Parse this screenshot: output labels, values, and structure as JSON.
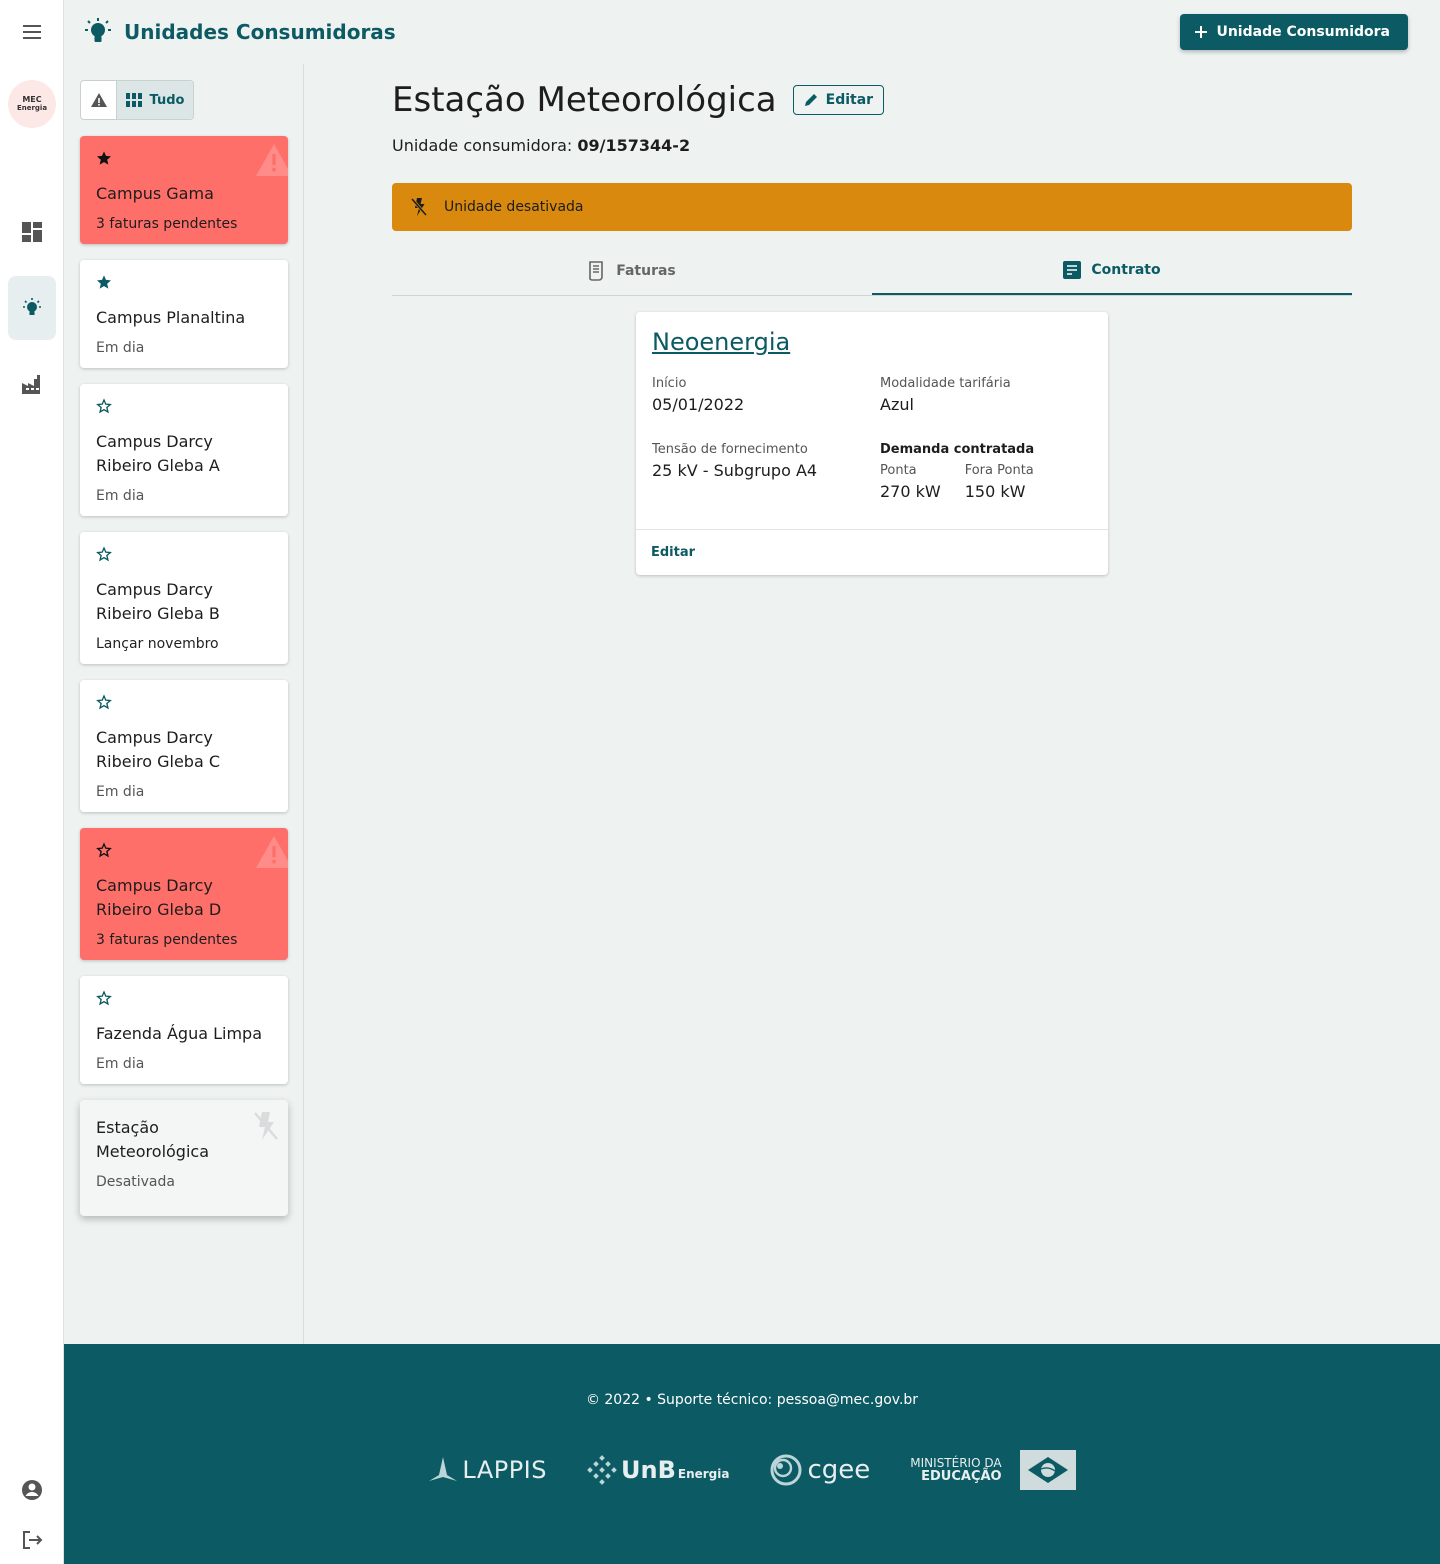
{
  "header": {
    "title": "Unidades Consumidoras",
    "add_button_label": "Unidade Consumidora"
  },
  "rail": {
    "logo_line1": "MEC",
    "logo_line2": "Energia"
  },
  "filter": {
    "all_label": "Tudo"
  },
  "units": [
    {
      "name": "Campus Gama",
      "status": "3 faturas pendentes",
      "favorite": true,
      "alert": true
    },
    {
      "name": "Campus Planaltina",
      "status": "Em dia",
      "favorite": true,
      "alert": false
    },
    {
      "name": "Campus Darcy Ribeiro Gleba A",
      "status": "Em dia",
      "favorite": false,
      "alert": false
    },
    {
      "name": "Campus Darcy Ribeiro Gleba B",
      "status": "Lançar novembro",
      "favorite": false,
      "alert": false
    },
    {
      "name": "Campus Darcy Ribeiro Gleba C",
      "status": "Em dia",
      "favorite": false,
      "alert": false
    },
    {
      "name": "Campus Darcy Ribeiro Gleba D",
      "status": "3 faturas pendentes",
      "favorite": false,
      "alert": true
    },
    {
      "name": "Fazenda Água Limpa",
      "status": "Em dia",
      "favorite": false,
      "alert": false
    },
    {
      "name": "Estação Meteorológica",
      "status": "Desativada",
      "favorite": false,
      "alert": false,
      "disabled": true
    }
  ],
  "main": {
    "title": "Estação Meteorológica",
    "edit_label": "Editar",
    "uc_label": "Unidade consumidora:",
    "uc_number": "09/157344-2",
    "banner": "Unidade desativada",
    "tabs": [
      {
        "label": "Faturas",
        "active": false
      },
      {
        "label": "Contrato",
        "active": true
      }
    ]
  },
  "contract": {
    "distributor": "Neoenergia",
    "start_label": "Início",
    "start_value": "05/01/2022",
    "tariff_label": "Modalidade tarifária",
    "tariff_value": "Azul",
    "voltage_label": "Tensão de fornecimento",
    "voltage_value": "25 kV - Subgrupo A4",
    "demand_label": "Demanda contratada",
    "peak_label": "Ponta",
    "peak_value": "270 kW",
    "offpeak_label": "Fora Ponta",
    "offpeak_value": "150 kW",
    "edit_label": "Editar"
  },
  "footer": {
    "copyright": "© 2022  •  Suporte técnico: pessoa@mec.gov.br",
    "partners": {
      "lappis": "LAPPIS",
      "unb": "UnB",
      "unb_sub": "Energia",
      "cgee": "cgee",
      "mec_line1": "MINISTÉRIO DA",
      "mec_line2": "EDUCAÇÃO"
    }
  },
  "colors": {
    "primary": "#0c5a63",
    "alert_card": "#ff6f6a",
    "banner": "#d8890e",
    "background": "#eef3f2"
  },
  "icons": {
    "menu": "menu-icon",
    "dashboard": "dashboard-icon",
    "units": "lightbulb-icon",
    "distributors": "factory-icon",
    "account": "account-icon",
    "logout": "logout-icon"
  }
}
